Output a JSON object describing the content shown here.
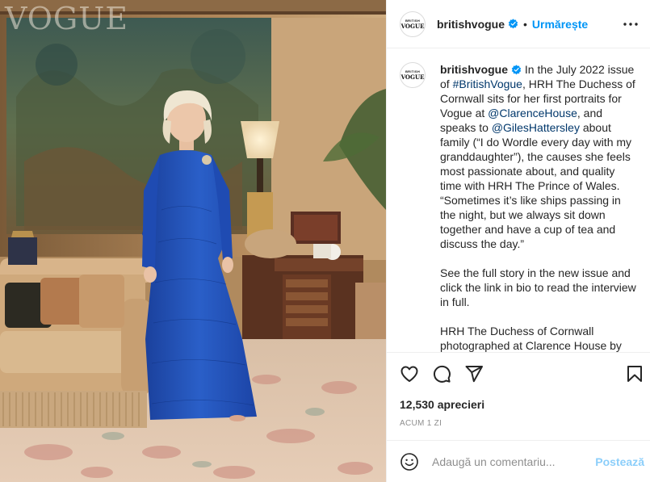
{
  "photo": {
    "masthead": "VOGUE",
    "alt": "The Duchess of Cornwall in a blue lace gown at Clarence House"
  },
  "account": {
    "avatar_line1": "BRITISH",
    "avatar_line2": "VOGUE",
    "username": "britishvogue",
    "verified": true,
    "separator": "•",
    "follow_label": "Urmărește"
  },
  "caption": {
    "username": "britishvogue",
    "segments": [
      {
        "text": " In the July 2022 issue of "
      },
      {
        "text": "#BritishVogue",
        "link": true
      },
      {
        "text": ", HRH The Duchess of Cornwall sits for her first portraits for Vogue at "
      },
      {
        "text": "@ClarenceHouse",
        "link": true
      },
      {
        "text": ", and speaks to "
      },
      {
        "text": "@GilesHattersley",
        "link": true
      },
      {
        "text": " about family (“I do Wordle every day with my granddaughter”), the causes she feels most passionate about, and quality time with HRH The Prince of Wales. “Sometimes it’s like ships passing in the night, but we always sit down together and have a cup of tea and discuss the day.”"
      }
    ],
    "paragraph2": "See the full story in the new issue and click the link in bio to read the interview in full.",
    "paragraph3": "HRH The Duchess of Cornwall photographed at Clarence House by"
  },
  "actions": {
    "icons": [
      "heart-icon",
      "comment-icon",
      "share-icon",
      "bookmark-icon"
    ],
    "likes": "12,530 aprecieri",
    "time_ago": "ACUM 1 ZI"
  },
  "comment": {
    "placeholder": "Adaugă un comentariu...",
    "post_label": "Postează"
  },
  "colors": {
    "accent": "#0095f6",
    "link": "#00376b",
    "text": "#262626",
    "muted": "#8e8e8e",
    "border": "#efefef"
  }
}
